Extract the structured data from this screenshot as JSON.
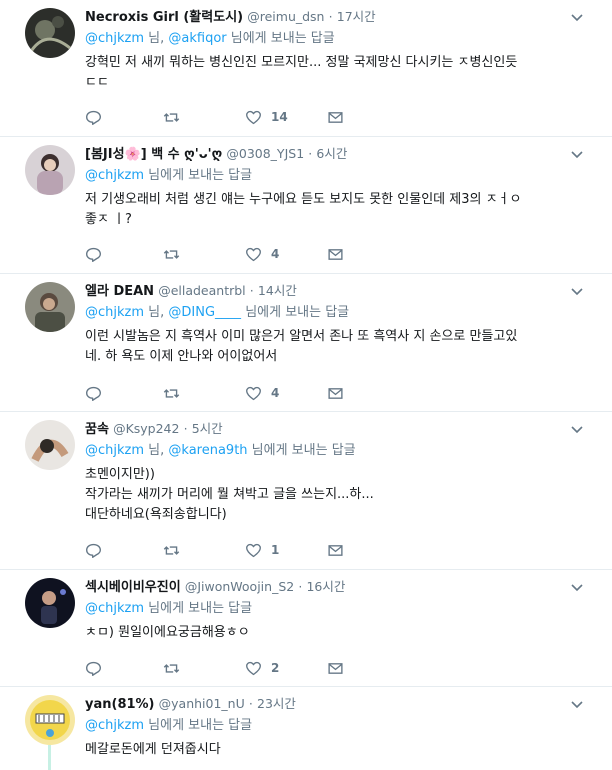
{
  "tweets": [
    {
      "name": "Necroxis Girl (활력도시)",
      "handle": "@reimu_dsn",
      "dot": "·",
      "time": "17시간",
      "mentions": [
        "@chjkzm",
        "@akfiqor"
      ],
      "reply_suffix": "님에게 보내는 답글",
      "mention_sep": "님,",
      "text": "강혁민 저 새끼 뭐하는 병신인진 모르지만... 정말 국제망신 다시키는 ㅈ병신인듯\nㄷㄷ",
      "likes": "14"
    },
    {
      "name": "[봄JI성🌸] 백 수 ღ'ᴗ'ღ",
      "handle": "@0308_YJS1",
      "dot": "·",
      "time": "6시간",
      "mentions": [
        "@chjkzm"
      ],
      "reply_suffix": "님에게 보내는 답글",
      "text": "저 기생오래비 처럼 생긴 얘는 누구에요 듣도 보지도 못한 인물인데 제3의 ㅈㅓㅇ\n좋ㅈ ㅣ?",
      "likes": "4"
    },
    {
      "name": "엘라 DEAN",
      "handle": "@elladeantrbl",
      "dot": "·",
      "time": "14시간",
      "mentions": [
        "@chjkzm",
        "@DING____"
      ],
      "reply_suffix": "님에게 보내는 답글",
      "mention_sep": "님,",
      "text": "이런 시발놈은 지 흑역사 이미 많은거 알면서 존나 또 흑역사 지 손으로 만들고있\n네. 하 욕도 이제 안나와 어이없어서",
      "likes": "4"
    },
    {
      "name": "꿈속",
      "handle": "@Ksyp242",
      "dot": "·",
      "time": "5시간",
      "mentions": [
        "@chjkzm",
        "@karena9th"
      ],
      "reply_suffix": "님에게 보내는 답글",
      "mention_sep": "님,",
      "text": "초멘이지만))\n작가라는 새끼가 머리에 뭘 쳐박고 글을 쓰는지...하...\n대단하네요(욕죄송합니다)",
      "likes": "1"
    },
    {
      "name": "섹시베이비우진이",
      "handle": "@JiwonWoojin_S2",
      "dot": "·",
      "time": "16시간",
      "mentions": [
        "@chjkzm"
      ],
      "reply_suffix": "님에게 보내는 답글",
      "text": "ㅊㅁ) 뭔일이에요궁금해용ㅎㅇ",
      "likes": "2"
    },
    {
      "name": "yan(81%)",
      "handle": "@yanhi01_nU",
      "dot": "·",
      "time": "23시간",
      "mentions": [
        "@chjkzm"
      ],
      "reply_suffix": "님에게 보내는 답글",
      "text": "메갈로돈에게 던져줍시다",
      "likes": ""
    }
  ],
  "icons": {
    "reply": "reply-icon",
    "retweet": "retweet-icon",
    "like": "heart-icon",
    "dm": "envelope-icon",
    "more": "chevron-down-icon"
  },
  "colors": {
    "mention": "#1da1f2",
    "muted": "#657786",
    "text": "#14171a"
  }
}
